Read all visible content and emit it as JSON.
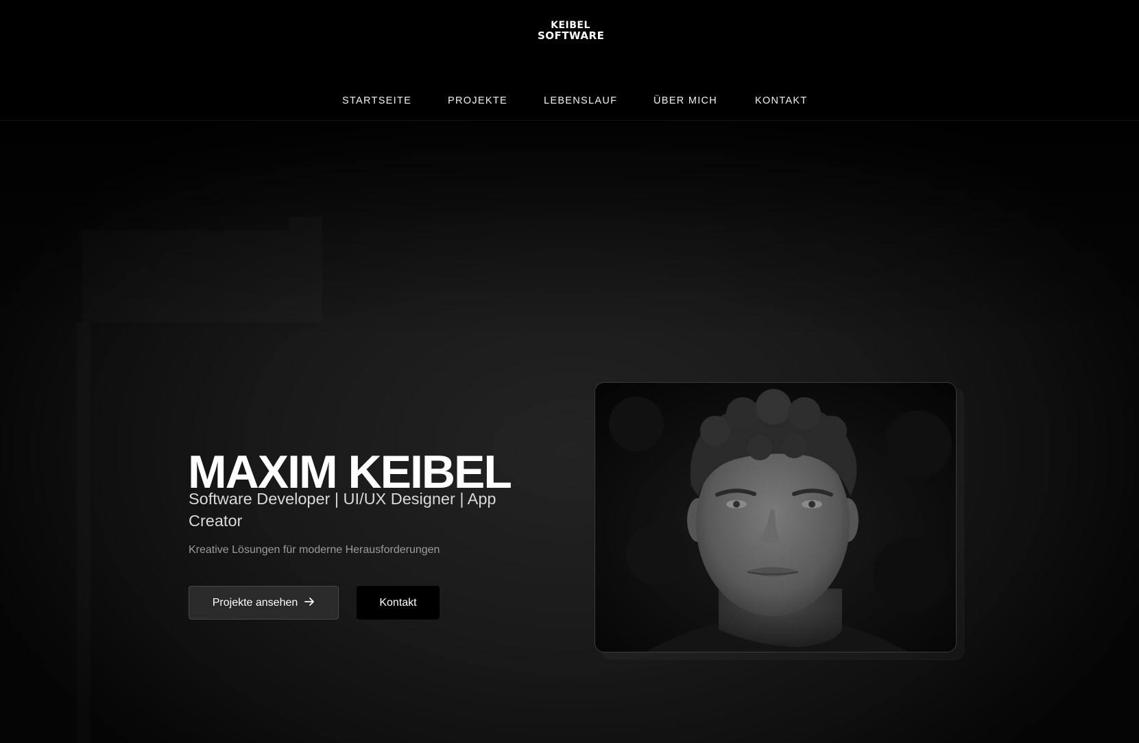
{
  "logo": {
    "line1": "KEIBEL",
    "line2": "SOFTWARE"
  },
  "nav": {
    "items": [
      {
        "label": "STARTSEITE"
      },
      {
        "label": "PROJEKTE"
      },
      {
        "label": "LEBENSLAUF"
      },
      {
        "label": "ÜBER MICH"
      },
      {
        "label": "KONTAKT"
      }
    ]
  },
  "hero": {
    "name": "MAXIM KEIBEL",
    "subtitle": "Software Developer | UI/UX Designer | App Creator",
    "tagline": "Kreative Lösungen für moderne Herausforderungen",
    "primary_button": "Projekte ansehen",
    "primary_button_icon": "arrow-right-icon",
    "secondary_button": "Kontakt"
  },
  "portrait": {
    "icon": "portrait-photo"
  },
  "colors": {
    "background": "#000000",
    "hero_background": "#1a1a1a",
    "text_primary": "#ffffff",
    "text_muted": "#9c9c9c",
    "button_secondary_bg": "#2a2a2a"
  }
}
